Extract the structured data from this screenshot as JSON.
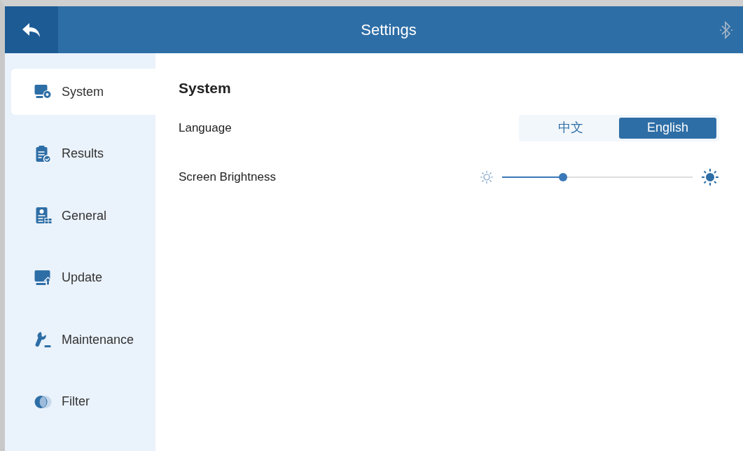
{
  "header": {
    "title": "Settings"
  },
  "sidebar": {
    "items": [
      {
        "label": "System",
        "selected": true
      },
      {
        "label": "Results",
        "selected": false
      },
      {
        "label": "General",
        "selected": false
      },
      {
        "label": "Update",
        "selected": false
      },
      {
        "label": "Maintenance",
        "selected": false
      },
      {
        "label": "Filter",
        "selected": false
      }
    ]
  },
  "content": {
    "title": "System",
    "language": {
      "label": "Language",
      "options": [
        {
          "label": "中文",
          "selected": false
        },
        {
          "label": "English",
          "selected": true
        }
      ]
    },
    "brightness": {
      "label": "Screen Brightness",
      "level": 0.32
    }
  }
}
